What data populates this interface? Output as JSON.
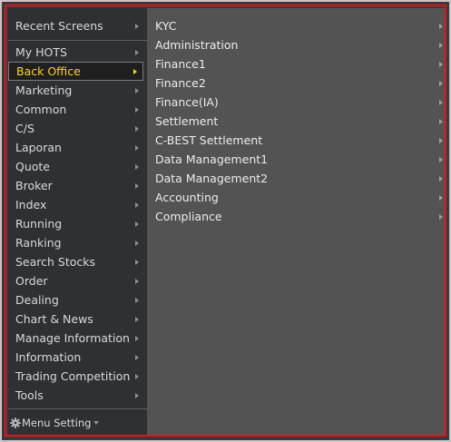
{
  "sidebar": {
    "recent_label": "Recent Screens",
    "items": [
      {
        "label": "My HOTS"
      },
      {
        "label": "Back Office",
        "selected": true
      },
      {
        "label": "Marketing"
      },
      {
        "label": "Common"
      },
      {
        "label": "C/S"
      },
      {
        "label": "Laporan"
      },
      {
        "label": "Quote"
      },
      {
        "label": "Broker"
      },
      {
        "label": "Index"
      },
      {
        "label": "Running"
      },
      {
        "label": "Ranking"
      },
      {
        "label": "Search Stocks"
      },
      {
        "label": "Order"
      },
      {
        "label": "Dealing"
      },
      {
        "label": "Chart & News"
      },
      {
        "label": "Manage Information"
      },
      {
        "label": "Information"
      },
      {
        "label": "Trading Competition"
      },
      {
        "label": "Tools"
      }
    ],
    "menu_setting_label": "Menu Setting"
  },
  "submenu": {
    "items": [
      {
        "label": "KYC"
      },
      {
        "label": "Administration"
      },
      {
        "label": "Finance1"
      },
      {
        "label": "Finance2"
      },
      {
        "label": "Finance(IA)"
      },
      {
        "label": "Settlement"
      },
      {
        "label": "C-BEST Settlement"
      },
      {
        "label": "Data Management1"
      },
      {
        "label": "Data Management2"
      },
      {
        "label": "Accounting"
      },
      {
        "label": "Compliance"
      }
    ]
  },
  "colors": {
    "selected_text": "#ffd21f",
    "highlight_border": "#e0141b"
  }
}
